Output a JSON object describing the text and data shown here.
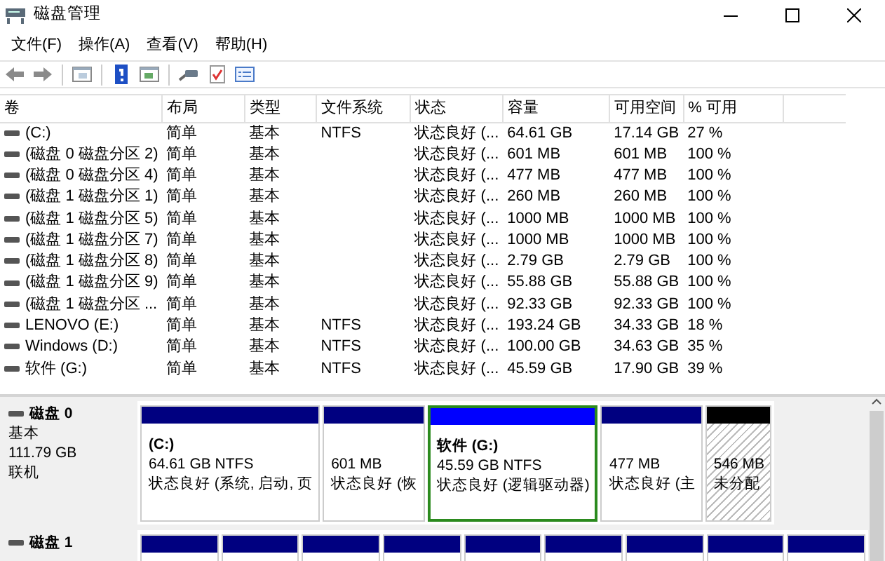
{
  "window": {
    "title": "磁盘管理"
  },
  "menu": [
    "文件(F)",
    "操作(A)",
    "查看(V)",
    "帮助(H)"
  ],
  "volumes": {
    "columns": [
      "卷",
      "布局",
      "类型",
      "文件系统",
      "状态",
      "容量",
      "可用空间",
      "% 可用"
    ],
    "rows": [
      {
        "cells": [
          "(C:)",
          "简单",
          "基本",
          "NTFS",
          "状态良好 (...",
          "64.61 GB",
          "17.14 GB",
          "27 %"
        ]
      },
      {
        "cells": [
          "(磁盘 0 磁盘分区 2)",
          "简单",
          "基本",
          "",
          "状态良好 (...",
          "601 MB",
          "601 MB",
          "100 %"
        ]
      },
      {
        "cells": [
          "(磁盘 0 磁盘分区 4)",
          "简单",
          "基本",
          "",
          "状态良好 (...",
          "477 MB",
          "477 MB",
          "100 %"
        ]
      },
      {
        "cells": [
          "(磁盘 1 磁盘分区 1)",
          "简单",
          "基本",
          "",
          "状态良好 (...",
          "260 MB",
          "260 MB",
          "100 %"
        ]
      },
      {
        "cells": [
          "(磁盘 1 磁盘分区 5)",
          "简单",
          "基本",
          "",
          "状态良好 (...",
          "1000 MB",
          "1000 MB",
          "100 %"
        ]
      },
      {
        "cells": [
          "(磁盘 1 磁盘分区 7)",
          "简单",
          "基本",
          "",
          "状态良好 (...",
          "1000 MB",
          "1000 MB",
          "100 %"
        ]
      },
      {
        "cells": [
          "(磁盘 1 磁盘分区 8)",
          "简单",
          "基本",
          "",
          "状态良好 (...",
          "2.79 GB",
          "2.79 GB",
          "100 %"
        ]
      },
      {
        "cells": [
          "(磁盘 1 磁盘分区 9)",
          "简单",
          "基本",
          "",
          "状态良好 (...",
          "55.88 GB",
          "55.88 GB",
          "100 %"
        ]
      },
      {
        "cells": [
          "(磁盘 1 磁盘分区 ...",
          "简单",
          "基本",
          "",
          "状态良好 (...",
          "92.33 GB",
          "92.33 GB",
          "100 %"
        ]
      },
      {
        "cells": [
          "LENOVO (E:)",
          "简单",
          "基本",
          "NTFS",
          "状态良好 (...",
          "193.24 GB",
          "34.33 GB",
          "18 %"
        ]
      },
      {
        "cells": [
          "Windows (D:)",
          "简单",
          "基本",
          "NTFS",
          "状态良好 (...",
          "100.00 GB",
          "34.63 GB",
          "35 %"
        ]
      },
      {
        "cells": [
          "软件 (G:)",
          "简单",
          "基本",
          "NTFS",
          "状态良好 (...",
          "45.59 GB",
          "17.90 GB",
          "39 %"
        ]
      }
    ]
  },
  "disks": [
    {
      "name": "磁盘 0",
      "type": "基本",
      "size": "111.79 GB",
      "status": "联机",
      "partitions": [
        {
          "kind": "primary",
          "selected": false,
          "name": "(C:)",
          "size": "64.61 GB NTFS",
          "status": "状态良好 (系统, 启动, 页"
        },
        {
          "kind": "primary",
          "selected": false,
          "size": "601 MB",
          "status": "状态良好 (恢"
        },
        {
          "kind": "logical",
          "selected": true,
          "name": "软件 (G:)",
          "size": "45.59 GB NTFS",
          "status": "状态良好 (逻辑驱动器)"
        },
        {
          "kind": "primary",
          "selected": false,
          "size": "477 MB",
          "status": "状态良好 (主"
        },
        {
          "kind": "unallocated",
          "selected": false,
          "size": "546 MB",
          "status": "未分配"
        }
      ]
    },
    {
      "name": "磁盘 1",
      "partitions": [
        {
          "kind": "primary",
          "selected": false
        },
        {
          "kind": "primary",
          "selected": false
        },
        {
          "kind": "primary",
          "selected": false
        },
        {
          "kind": "primary",
          "selected": false
        },
        {
          "kind": "primary",
          "selected": false
        },
        {
          "kind": "primary",
          "selected": false
        },
        {
          "kind": "primary",
          "selected": false
        },
        {
          "kind": "primary",
          "selected": false
        },
        {
          "kind": "primary",
          "selected": false
        }
      ]
    }
  ]
}
